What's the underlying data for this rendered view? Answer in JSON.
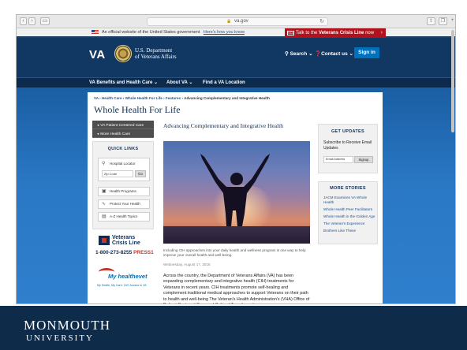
{
  "browser": {
    "url": "va.gov"
  },
  "gov_banner": {
    "text": "An official website of the United States government",
    "link": "Here's how you know"
  },
  "crisis_button": {
    "prefix": "Talk to the",
    "bold": "Veterans Crisis Line",
    "suffix": "now",
    "arrow": "›"
  },
  "header": {
    "logo": "VA",
    "dept_line1": "U.S. Department",
    "dept_line2": "of Veterans Affairs",
    "search": "Search",
    "contact": "Contact us",
    "sign_in": "Sign in"
  },
  "nav": {
    "items": [
      "VA Benefits and Health Care",
      "About VA",
      "Find a VA Location"
    ]
  },
  "breadcrumb": {
    "parts": [
      "VA",
      "Health Care",
      "Whole Health For Life",
      "Features",
      "Advancing Complementary and Integrative Health"
    ]
  },
  "page": {
    "title": "Whole Health For Life"
  },
  "side_nav": {
    "items": [
      "VA Patient Centered Care",
      "More Health Care"
    ]
  },
  "quick_links": {
    "heading": "QUICK LINKS",
    "locator": "Hospital Locator",
    "zip_placeholder": "Zip Code",
    "go": "Go",
    "buttons": [
      "Health Programs",
      "Protect Your Health",
      "A-Z Health Topics"
    ]
  },
  "crisis_line_logo": {
    "line1": "Veterans",
    "line2": "Crisis Line",
    "phone": "1-800-273-8255",
    "press": "PRESS",
    "press_num": "1"
  },
  "myhealthevet": {
    "name": "My healthevet",
    "tagline": "My Health, My Care: 24/7 Access to VA"
  },
  "article": {
    "title": "Advancing Complementary and Integrative Health",
    "caption": "Including CIH approaches into your daily health and wellness program is one way to help improve your overall health and well-being.",
    "date": "Wednesday, August 17, 2016",
    "body": "Across the country, the Department of Veterans Affairs (VA) has been expanding complementary and integrative health (CIH) treatments for Veterans in recent years.  CIH treatments promote self-healing and complement traditional medical approaches to support Veterans on their path to health and well-being  The Veteran's Health Administration's (VHA) Office of Patient Centered Care and Cultural Transformation"
  },
  "updates": {
    "heading": "GET UPDATES",
    "desc": "Subscribe to Receive Email Updates",
    "email_placeholder": "Email Address",
    "signup": "Signup"
  },
  "more_stories": {
    "heading": "MORE STORIES",
    "items": [
      "JACM Examines VA Whole Health",
      "Whole Health Peer Facilitators",
      "Whole Health in the Golden Age",
      "The Veteran's Experience",
      "Brothers Like These"
    ]
  },
  "footer": {
    "line1": "MONMOUTH",
    "line2": "UNIVERSITY"
  }
}
